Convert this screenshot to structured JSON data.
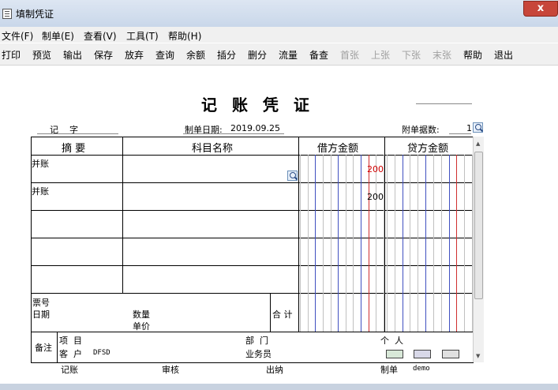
{
  "window": {
    "title": "填制凭证",
    "close": "x"
  },
  "menu": [
    "文件(F)",
    "制单(E)",
    "查看(V)",
    "工具(T)",
    "帮助(H)"
  ],
  "toolbar": {
    "buttons": [
      {
        "label": "打印",
        "enabled": true
      },
      {
        "label": "预览",
        "enabled": true
      },
      {
        "label": "输出",
        "enabled": true
      },
      {
        "label": "保存",
        "enabled": true
      },
      {
        "label": "放弃",
        "enabled": true
      },
      {
        "label": "查询",
        "enabled": true
      },
      {
        "label": "余额",
        "enabled": true
      },
      {
        "label": "插分",
        "enabled": true
      },
      {
        "label": "删分",
        "enabled": true
      },
      {
        "label": "流量",
        "enabled": true
      },
      {
        "label": "备查",
        "enabled": true
      },
      {
        "label": "首张",
        "enabled": false
      },
      {
        "label": "上张",
        "enabled": false
      },
      {
        "label": "下张",
        "enabled": false
      },
      {
        "label": "末张",
        "enabled": false
      },
      {
        "label": "帮助",
        "enabled": true
      },
      {
        "label": "退出",
        "enabled": true
      }
    ]
  },
  "voucher": {
    "title": "记 账 凭 证",
    "type_label": "记    字",
    "date_label": "制单日期:",
    "date": "2019.09.25",
    "attach_label": "附单据数:",
    "attach_count": "1",
    "columns": {
      "summary": "摘 要",
      "account": "科目名称",
      "debit": "借方金额",
      "credit": "贷方金额"
    },
    "rows": [
      {
        "summary": "并账",
        "account": "",
        "debit": "200",
        "credit": "",
        "debit_color": "#d00000"
      },
      {
        "summary": "并账",
        "account": "",
        "debit": "200",
        "credit": "",
        "debit_color": "#000000"
      },
      {
        "summary": "",
        "account": "",
        "debit": "",
        "credit": ""
      },
      {
        "summary": "",
        "account": "",
        "debit": "",
        "credit": ""
      },
      {
        "summary": "",
        "account": "",
        "debit": "",
        "credit": ""
      }
    ],
    "footer": {
      "ticket_no": "票号",
      "date": "日期",
      "qty": "数量",
      "unit_price": "单价",
      "total": "合 计"
    },
    "remarks": {
      "label": "备注",
      "project": "项  目",
      "customer": "客  户",
      "customer_value": "DFSD",
      "dept": "部  门",
      "salesman": "业务员",
      "person": "个  人"
    },
    "signatures": {
      "bookkeeper": "记账",
      "auditor": "审核",
      "cashier": "出纳",
      "preparer": "制单",
      "preparer_value": "demo"
    }
  },
  "colors": {
    "debit_red": "#d00000",
    "grid_blue": "#4050c0",
    "grid_red": "#d03030",
    "grid_gray": "#c0c0c0"
  }
}
